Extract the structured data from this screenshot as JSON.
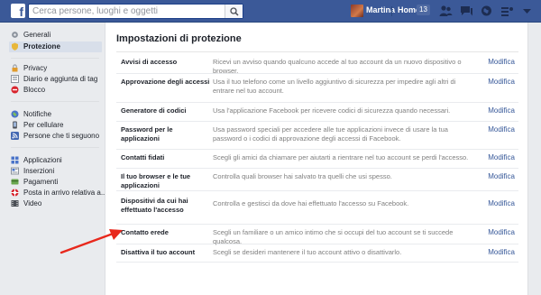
{
  "topbar": {
    "logo": "f",
    "search_placeholder": "Cerca persone, luoghi e oggetti",
    "user_name": "Martina",
    "home_label": "Home",
    "home_count": "13",
    "brand_color": "#3b5998"
  },
  "sidebar": {
    "groups": [
      [
        {
          "label": "Generali",
          "icon": "gear-icon"
        },
        {
          "label": "Protezione",
          "icon": "shield-icon",
          "active": true
        }
      ],
      [
        {
          "label": "Privacy",
          "icon": "lock-icon"
        },
        {
          "label": "Diario e aggiunta di tag",
          "icon": "timeline-icon"
        },
        {
          "label": "Blocco",
          "icon": "block-icon"
        }
      ],
      [
        {
          "label": "Notifiche",
          "icon": "globe-icon"
        },
        {
          "label": "Per cellulare",
          "icon": "mobile-icon"
        },
        {
          "label": "Persone che ti seguono",
          "icon": "rss-icon"
        }
      ],
      [
        {
          "label": "Applicazioni",
          "icon": "apps-icon"
        },
        {
          "label": "Inserzioni",
          "icon": "ads-icon"
        },
        {
          "label": "Pagamenti",
          "icon": "payments-icon"
        },
        {
          "label": "Posta in arrivo relativa a...",
          "icon": "lifebuoy-icon"
        },
        {
          "label": "Video",
          "icon": "video-icon"
        }
      ]
    ]
  },
  "main": {
    "title": "Impostazioni di protezione",
    "edit_label": "Modifica",
    "rows": [
      {
        "name": "Avvisi di accesso",
        "desc": "Ricevi un avviso quando qualcuno accede al tuo account da un nuovo dispositivo o browser."
      },
      {
        "name": "Approvazione degli accessi",
        "desc": "Usa il tuo telefono come un livello aggiuntivo di sicurezza per impedire agli altri di entrare nel tuo account."
      },
      {
        "name": "Generatore di codici",
        "desc": "Usa l'applicazione Facebook per ricevere codici di sicurezza quando necessari."
      },
      {
        "name": "Password per le applicazioni",
        "desc": "Usa password speciali per accedere alle tue applicazioni invece di usare la tua password o i codici di approvazione degli accessi di Facebook."
      },
      {
        "name": "Contatti fidati",
        "desc": "Scegli gli amici da chiamare per aiutarti a rientrare nel tuo account se perdi l'accesso."
      },
      {
        "name": "Il tuo browser e le tue applicazioni",
        "desc": "Controlla quali browser hai salvato tra quelli che usi spesso."
      },
      {
        "name": "Dispositivi da cui hai effettuato l'accesso",
        "desc": "Controlla e gestisci da dove hai effettuato l'accesso su Facebook."
      },
      {
        "name": "Contatto erede",
        "desc": "Scegli un familiare o un amico intimo che si occupi del tuo account se ti succede qualcosa."
      },
      {
        "name": "Disattiva il tuo account",
        "desc": "Scegli se desideri mantenere il tuo account attivo o disattivarlo."
      }
    ]
  },
  "annotation": {
    "arrow_color": "#e8281c"
  }
}
